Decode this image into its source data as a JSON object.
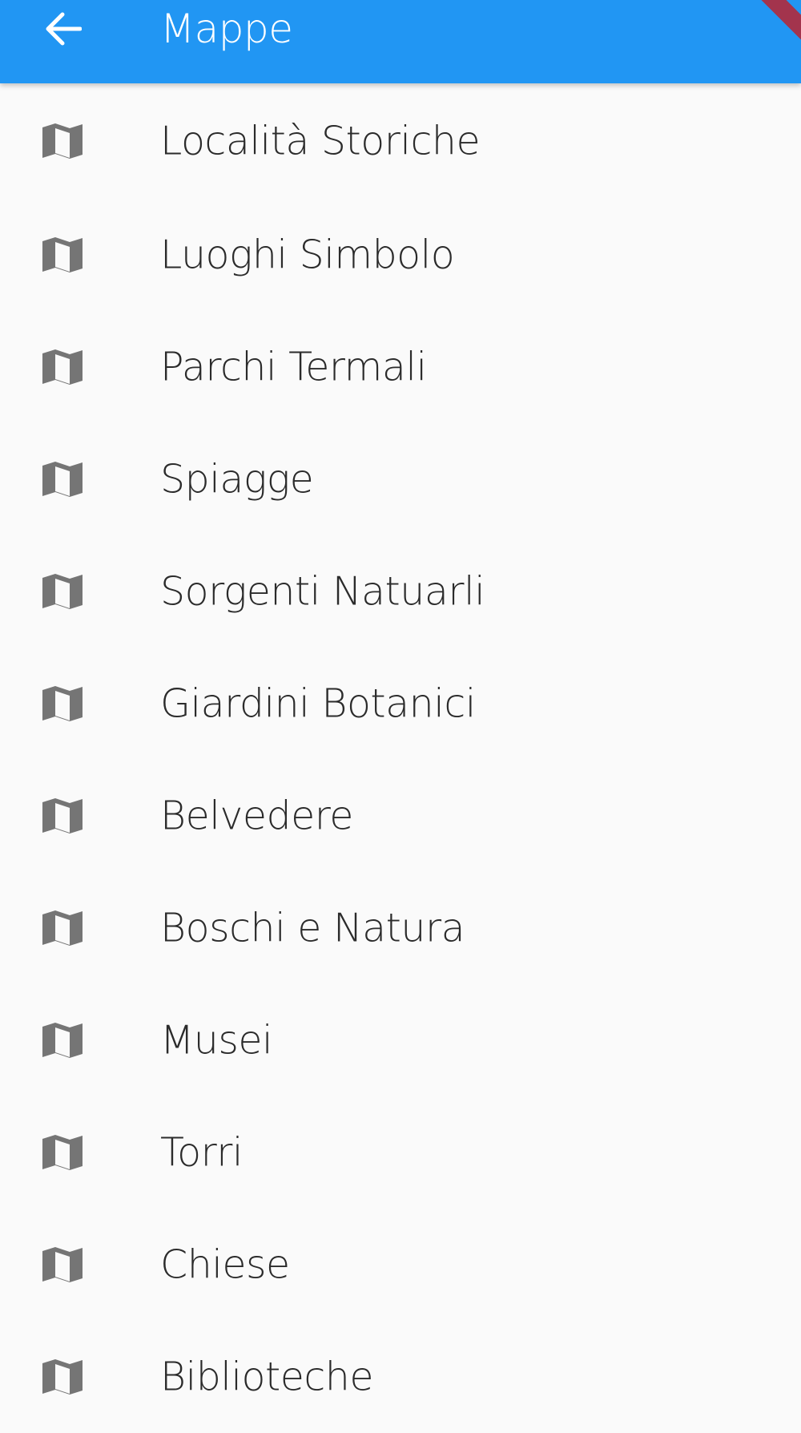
{
  "app_bar": {
    "title": "Mappe",
    "back_icon": "arrow-left-icon",
    "color": "#2196F3"
  },
  "list": {
    "icon": "map-icon",
    "icon_color": "#757575",
    "items": [
      {
        "label": "Località Storiche"
      },
      {
        "label": "Luoghi Simbolo"
      },
      {
        "label": "Parchi Termali"
      },
      {
        "label": "Spiagge"
      },
      {
        "label": "Sorgenti Natuarli"
      },
      {
        "label": "Giardini Botanici"
      },
      {
        "label": "Belvedere"
      },
      {
        "label": "Boschi e Natura"
      },
      {
        "label": "Musei"
      },
      {
        "label": "Torri"
      },
      {
        "label": "Chiese"
      },
      {
        "label": "Biblioteche"
      }
    ]
  }
}
